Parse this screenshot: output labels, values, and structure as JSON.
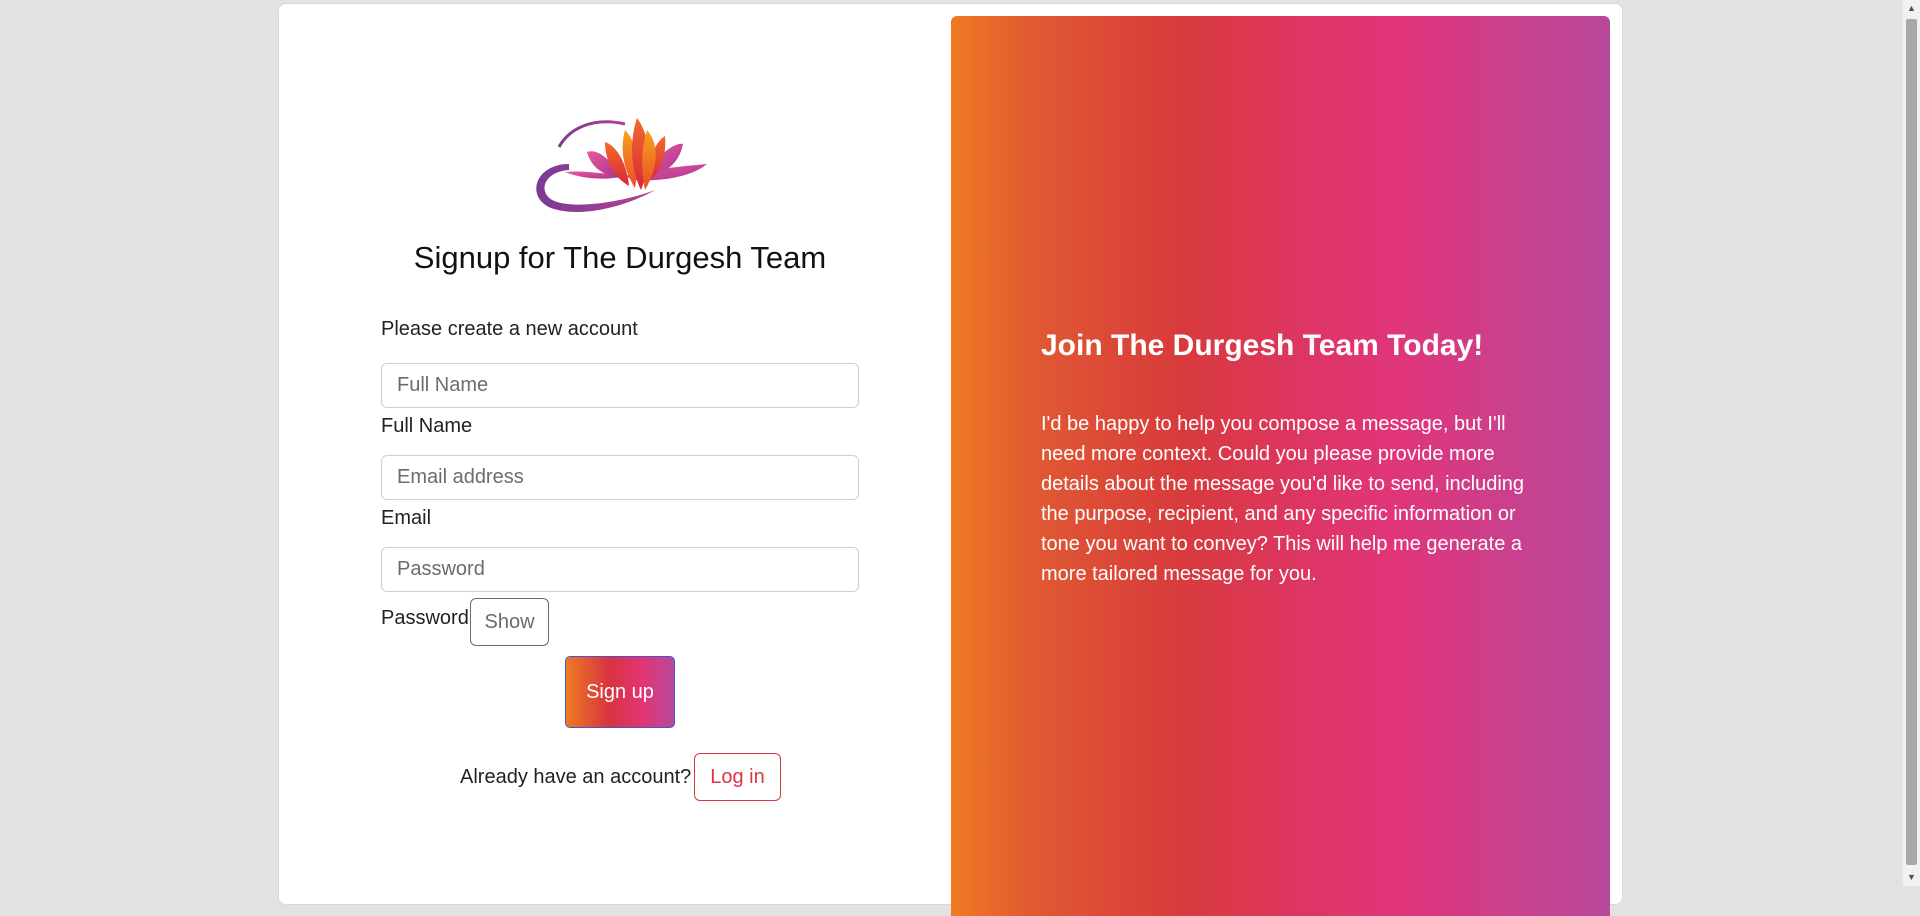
{
  "app": {
    "title": "Signup for The Durgesh Team"
  },
  "signup": {
    "title": "Signup for The Durgesh Team",
    "subtitle": "Please create a new account",
    "fields": {
      "full_name": {
        "placeholder": "Full Name",
        "label": "Full Name",
        "value": ""
      },
      "email": {
        "placeholder": "Email address",
        "label": "Email",
        "value": ""
      },
      "password": {
        "placeholder": "Password",
        "label": "Password",
        "value": ""
      }
    },
    "show_label": "Show",
    "submit_label": "Sign up",
    "already_text": "Already have an account?",
    "login_label": "Log in"
  },
  "promo": {
    "heading": "Join The Durgesh Team Today!",
    "body": "I'd be happy to help you compose a message, but I'll need more context. Could you please provide more details about the message you'd like to send, including the purpose, recipient, and any specific information or tone you want to convey? This will help me generate a more tailored message for you."
  },
  "icons": {
    "logo": "lotus-logo-icon",
    "scroll_up": "scroll-up-arrow-icon",
    "scroll_down": "scroll-down-arrow-icon"
  },
  "colors": {
    "gradient_start": "#ef7a23",
    "gradient_mid": "#d83a3c",
    "gradient_pink": "#e0357a",
    "gradient_end": "#b8489a",
    "login_red": "#dc3545",
    "page_bg": "#e2e2e2"
  }
}
